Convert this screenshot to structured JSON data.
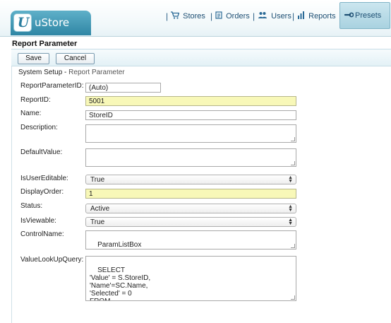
{
  "header": {
    "logo_text": "uStore",
    "logo_mark": "U",
    "nav": [
      {
        "label": "Stores",
        "icon": "cart-icon"
      },
      {
        "label": "Orders",
        "icon": "orders-icon"
      },
      {
        "label": "Users",
        "icon": "users-icon"
      },
      {
        "label": "Reports",
        "icon": "bar-chart-icon"
      }
    ],
    "active_tab": {
      "label": "Presets",
      "icon": "wrench-icon"
    }
  },
  "page_title": "Report Parameter",
  "toolbar": {
    "save_label": "Save",
    "cancel_label": "Cancel"
  },
  "breadcrumb": {
    "root": "System Setup",
    "separator": " - ",
    "current": "Report Parameter"
  },
  "form": {
    "report_parameter_id": {
      "label": "ReportParameterID:",
      "value": "(Auto)"
    },
    "report_id": {
      "label": "ReportID:",
      "value": "5001"
    },
    "name": {
      "label": "Name:",
      "value": "StoreID"
    },
    "description": {
      "label": "Description:",
      "value": ""
    },
    "default_value": {
      "label": "DefaultValue:",
      "value": ""
    },
    "is_user_editable": {
      "label": "IsUserEditable:",
      "value": "True"
    },
    "display_order": {
      "label": "DisplayOrder:",
      "value": "1"
    },
    "status": {
      "label": "Status:",
      "value": "Active"
    },
    "is_viewable": {
      "label": "IsViewable:",
      "value": "True"
    },
    "control_name": {
      "label": "ControlName:",
      "value": "ParamListBox"
    },
    "value_lookup_query": {
      "label": "ValueLookUpQuery:",
      "value": "SELECT\n'Value' = S.StoreID,\n'Name'=SC.Name,\n'Selected' = 0\nFROM\nStore S Join Store_Culture SC ON (S.StoreID=SC.StoreID and"
    }
  },
  "colors": {
    "accent": "#2f86a4",
    "required_field": "#f8f8b8",
    "nav_text": "#1d4f73"
  }
}
